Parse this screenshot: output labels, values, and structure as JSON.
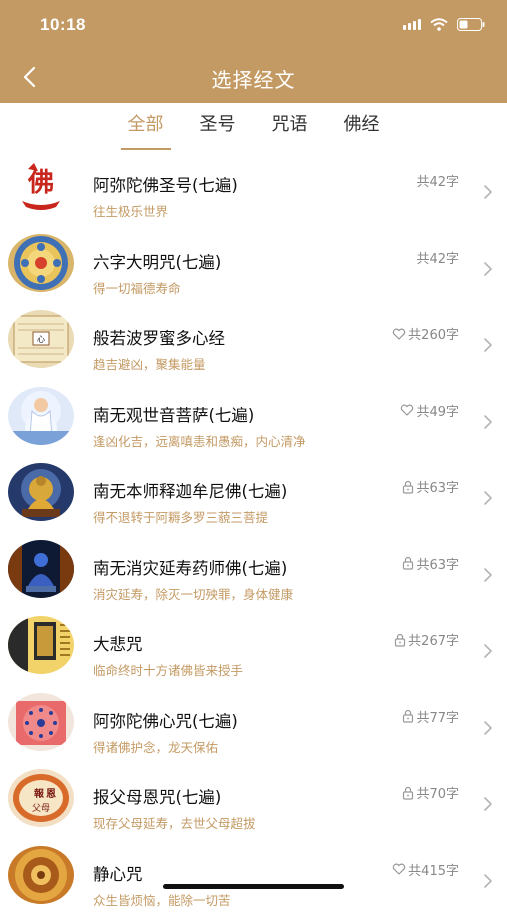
{
  "status": {
    "time": "10:18"
  },
  "header": {
    "title": "选择经文"
  },
  "tabs": [
    {
      "label": "全部",
      "active": true
    },
    {
      "label": "圣号",
      "active": false
    },
    {
      "label": "咒语",
      "active": false
    },
    {
      "label": "佛经",
      "active": false
    }
  ],
  "items": [
    {
      "name": "阿弥陀佛圣号(七遍)",
      "desc": "往生极乐世界",
      "count": "共42字",
      "badge": "none",
      "thumb": "fo-calligraphy"
    },
    {
      "name": "六字大明咒(七遍)",
      "desc": "得一切福德寿命",
      "count": "共42字",
      "badge": "none",
      "thumb": "mandala"
    },
    {
      "name": "般若波罗蜜多心经",
      "desc": "趋吉避凶，聚集能量",
      "count": "共260字",
      "badge": "heart",
      "thumb": "scroll"
    },
    {
      "name": "南无观世音菩萨(七遍)",
      "desc": "逢凶化吉，远离嗔恚和愚痴，内心清净",
      "count": "共49字",
      "badge": "heart",
      "thumb": "guanyin"
    },
    {
      "name": "南无本师释迦牟尼佛(七遍)",
      "desc": "得不退转于阿耨多罗三藐三菩提",
      "count": "共63字",
      "badge": "lock",
      "thumb": "buddha-gold"
    },
    {
      "name": "南无消灾延寿药师佛(七遍)",
      "desc": "消灾延寿，除灭一切殃罪，身体健康",
      "count": "共63字",
      "badge": "lock",
      "thumb": "buddha-blue"
    },
    {
      "name": "大悲咒",
      "desc": "临命终时十方诸佛皆来授手",
      "count": "共267字",
      "badge": "lock",
      "thumb": "dabei"
    },
    {
      "name": "阿弥陀佛心咒(七遍)",
      "desc": "得诸佛护念，龙天保佑",
      "count": "共77字",
      "badge": "lock",
      "thumb": "red-mandala"
    },
    {
      "name": "报父母恩咒(七遍)",
      "desc": "现存父母延寿，去世父母超拔",
      "count": "共70字",
      "badge": "lock",
      "thumb": "seal"
    },
    {
      "name": "静心咒",
      "desc": "众生皆烦恼，能除一切苦",
      "count": "共415字",
      "badge": "heart",
      "thumb": "gold-mandala"
    }
  ],
  "colors": {
    "accent": "#c49a64"
  }
}
